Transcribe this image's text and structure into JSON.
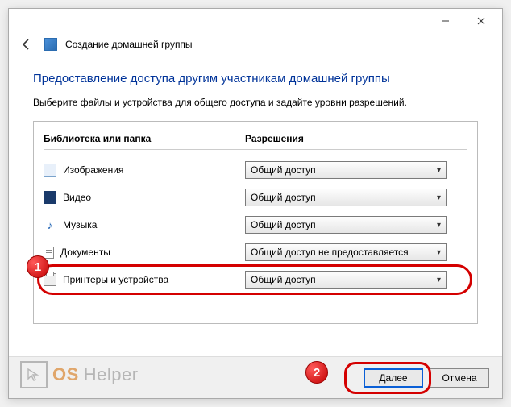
{
  "window": {
    "title": "Создание домашней группы"
  },
  "page": {
    "heading": "Предоставление доступа другим участникам домашней группы",
    "instruction": "Выберите файлы и устройства для общего доступа и задайте уровни разрешений."
  },
  "columns": {
    "library": "Библиотека или папка",
    "permission": "Разрешения"
  },
  "rows": [
    {
      "label": "Изображения",
      "permission": "Общий доступ",
      "icon": "pictures-icon"
    },
    {
      "label": "Видео",
      "permission": "Общий доступ",
      "icon": "video-icon"
    },
    {
      "label": "Музыка",
      "permission": "Общий доступ",
      "icon": "music-icon"
    },
    {
      "label": "Документы",
      "permission": "Общий доступ не предоставляется",
      "icon": "documents-icon"
    },
    {
      "label": "Принтеры и устройства",
      "permission": "Общий доступ",
      "icon": "printer-icon"
    }
  ],
  "buttons": {
    "next": "Далее",
    "cancel": "Отмена"
  },
  "annotations": {
    "badge1": "1",
    "badge2": "2"
  },
  "watermark": {
    "os": "OS",
    "helper": "Helper"
  }
}
